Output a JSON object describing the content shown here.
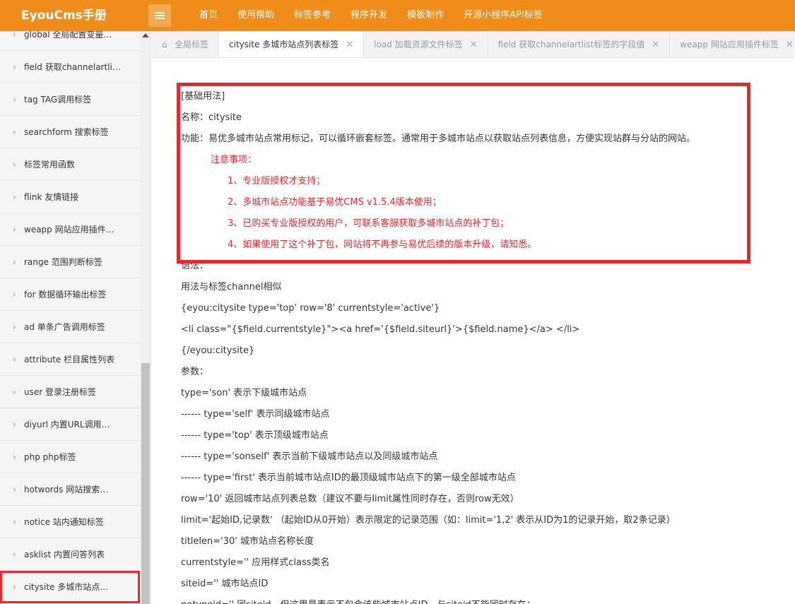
{
  "app": {
    "logo": "EyouCms手册"
  },
  "nav": [
    "首页",
    "使用帮助",
    "标签参考",
    "程序开发",
    "模板制作",
    "开源小程序API标签"
  ],
  "sidebar": {
    "items": [
      "global 全局配置变量…",
      "field 获取channelartli…",
      "tag TAG调用标签",
      "searchform 搜索标签",
      "标签常用函数",
      "flink 友情链接",
      "weapp 网站应用插件…",
      "range 范围判断标签",
      "for 数据循环输出标签",
      "ad 单条广告调用标签",
      "attribute 栏目属性列表",
      "user 登录注册标签",
      "diyurl 内置URL调用…",
      "php php标签",
      "hotwords 网站搜索…",
      "notice 站内通知标签",
      "asklist 内置问答列表",
      "citysite 多城市站点…"
    ],
    "active_index": 17
  },
  "tabs": [
    {
      "label": "全局标签",
      "home": true,
      "closable": false,
      "active": false
    },
    {
      "label": "citysite 多城市站点列表标签",
      "closable": true,
      "active": true
    },
    {
      "label": "load 加载资源文件标签",
      "closable": true,
      "active": false
    },
    {
      "label": "field 获取channelartlist标签的字段值",
      "closable": true,
      "active": false
    },
    {
      "label": "weapp 网站应用插件标签",
      "closable": true,
      "active": false
    }
  ],
  "doc": {
    "lines": [
      {
        "text": "[基础用法]",
        "style": ""
      },
      {
        "text": "名称：citysite",
        "style": ""
      },
      {
        "text": "功能：易优多城市站点常用标记，可以循环嵌套标签。通常用于多城市站点以获取站点列表信息，方便实现站群与分站的网站。",
        "style": ""
      },
      {
        "text": "注意事项：",
        "style": "red indent1"
      },
      {
        "text": "1、专业版授权才支持；",
        "style": "red indent2"
      },
      {
        "text": "2、多城市站点功能基于易优CMS v1.5.4版本使用；",
        "style": "red indent2"
      },
      {
        "text": "3、已购买专业版授权的用户，可联系客服获取多城市站点的补丁包；",
        "style": "red indent2"
      },
      {
        "text": "4、如果使用了这个补丁包，网站将不再参与易优后续的版本升级，请知悉。",
        "style": "red indent2"
      },
      {
        "text": "语法：",
        "style": ""
      },
      {
        "text": "用法与标签channel相似",
        "style": ""
      },
      {
        "text": "{eyou:citysite type='top' row='8' currentstyle='active'}",
        "style": ""
      },
      {
        "text": "<li class=\"{$field.currentstyle}\"><a href='{$field.siteurl}'>{$field.name}</a> </li>",
        "style": ""
      },
      {
        "text": "{/eyou:citysite}",
        "style": ""
      },
      {
        "text": "参数：",
        "style": ""
      },
      {
        "text": "type='son' 表示下级城市站点",
        "style": ""
      },
      {
        "text": "------ type='self' 表示同级城市站点",
        "style": ""
      },
      {
        "text": "------ type='top' 表示顶级城市站点",
        "style": ""
      },
      {
        "text": "------ type='sonself' 表示当前下级城市站点以及同级城市站点",
        "style": ""
      },
      {
        "text": "------ type='first' 表示当前城市站点ID的最顶级城市站点下的第一级全部城市站点",
        "style": ""
      },
      {
        "text": "row='10' 返回城市站点列表总数（建议不要与limit属性同时存在，否则row无效）",
        "style": ""
      },
      {
        "text": "limit='起始ID,记录数' （起始ID从0开始）表示限定的记录范围（如：limit='1,2' 表示从ID为1的记录开始，取2条记录）",
        "style": ""
      },
      {
        "text": "titlelen='30' 城市站点名称长度",
        "style": ""
      },
      {
        "text": "currentstyle='' 应用样式class类名",
        "style": ""
      },
      {
        "text": "siteid='' 城市站点ID",
        "style": ""
      },
      {
        "text": "notypeid='' 同siteid，但这里是表示不包含该些城市站点ID，与siteid不能同时存在；",
        "style": ""
      }
    ]
  },
  "colors": {
    "brand": "#f08c1a",
    "highlight": "#e8262e"
  }
}
